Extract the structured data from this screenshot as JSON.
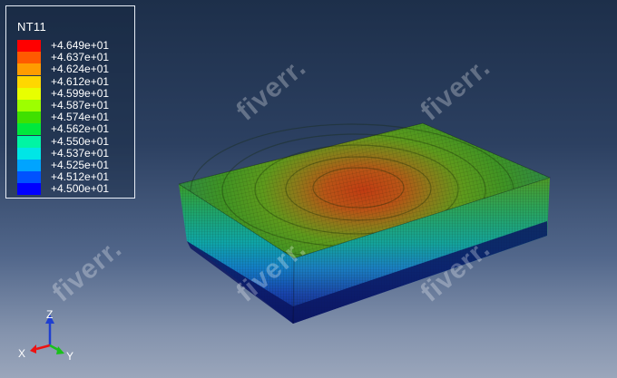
{
  "legend": {
    "title": "NT11",
    "entries": [
      {
        "label": "+4.649e+01",
        "color": "#ff0000"
      },
      {
        "label": "+4.637e+01",
        "color": "#ff5a00"
      },
      {
        "label": "+4.624e+01",
        "color": "#ff9c00"
      },
      {
        "label": "+4.612e+01",
        "color": "#ffd700"
      },
      {
        "label": "+4.599e+01",
        "color": "#e8ff00"
      },
      {
        "label": "+4.587e+01",
        "color": "#9dff00"
      },
      {
        "label": "+4.574e+01",
        "color": "#3fe000"
      },
      {
        "label": "+4.562e+01",
        "color": "#00e83c"
      },
      {
        "label": "+4.550e+01",
        "color": "#00f5a4"
      },
      {
        "label": "+4.537e+01",
        "color": "#00e6e6"
      },
      {
        "label": "+4.525e+01",
        "color": "#00a4ff"
      },
      {
        "label": "+4.512e+01",
        "color": "#0052ff"
      },
      {
        "label": "+4.500e+01",
        "color": "#0000ff"
      }
    ]
  },
  "triad": {
    "z_label": "Z",
    "x_label": "X",
    "y_label": "Y"
  },
  "watermark": {
    "text": "fiverr."
  }
}
